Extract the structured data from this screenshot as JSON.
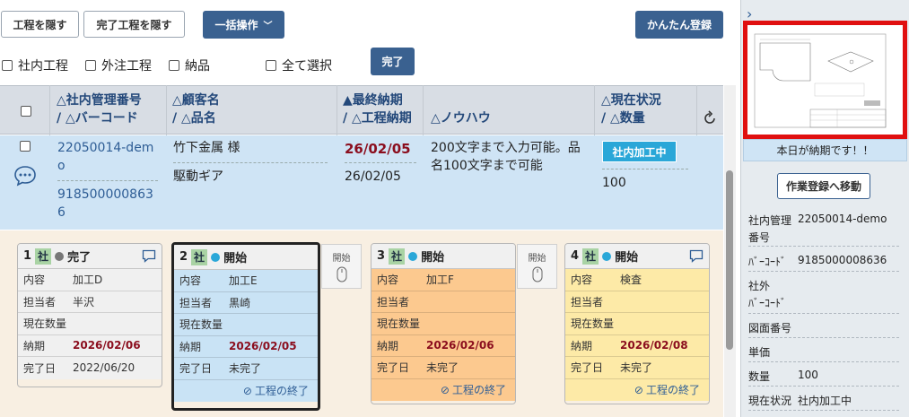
{
  "toolbar": {
    "hide_process": "工程を隠す",
    "hide_done": "完了工程を隠す",
    "bulk": "一括操作",
    "quick_register": "かんたん登録",
    "complete": "完了"
  },
  "filters": {
    "internal": "社内工程",
    "external": "外注工程",
    "delivery": "納品",
    "select_all": "全て選択"
  },
  "header": {
    "col1_a": "△社内管理番号",
    "col1_b": "/ △バーコード",
    "col2_a": "△顧客名",
    "col2_b": "/ △品名",
    "col3_a": "▲最終納期",
    "col3_b": "/ △工程納期",
    "col4": "△ノウハウ",
    "col5_a": "△現在状況",
    "col5_b": "/ △数量"
  },
  "row": {
    "mgmt_no_l1": "22050014-dem",
    "mgmt_no_l2": "o",
    "barcode_l1": "918500000863",
    "barcode_l2": "6",
    "customer": "竹下金属 様",
    "product": "駆動ギア",
    "final_due": "26/02/05",
    "process_due": "26/02/05",
    "knowhow_l1": "200文字まで入力可能。品",
    "knowhow_l2": "名100文字まで可能",
    "status": "社内加工中",
    "qty": "100"
  },
  "cards": [
    {
      "num": "1",
      "sha": "社",
      "state": "完了",
      "dot": "#777777",
      "bg": "#f0f0f0",
      "body": "#f0f0f0",
      "rows": [
        [
          "内容",
          "加工D"
        ],
        [
          "担当者",
          "半沢"
        ],
        [
          "現在数量",
          ""
        ],
        [
          "納期",
          "2026/02/06"
        ],
        [
          "完了日",
          "2022/06/20"
        ]
      ],
      "foot": ""
    },
    {
      "num": "2",
      "sha": "社",
      "state": "開始",
      "dot": "#2aa7d8",
      "bg": "#c9e3f5",
      "body": "#c9e3f5",
      "rows": [
        [
          "内容",
          "加工E"
        ],
        [
          "担当者",
          "黒崎"
        ],
        [
          "現在数量",
          ""
        ],
        [
          "納期",
          "2026/02/05"
        ],
        [
          "完了日",
          "未完了"
        ]
      ],
      "foot": "工程の終了"
    },
    {
      "num": "3",
      "sha": "社",
      "state": "開始",
      "dot": "#2aa7d8",
      "bg": "#f0f0f0",
      "body": "#fcc98f",
      "rows": [
        [
          "内容",
          "加工F"
        ],
        [
          "担当者",
          ""
        ],
        [
          "現在数量",
          ""
        ],
        [
          "納期",
          "2026/02/06"
        ],
        [
          "完了日",
          "未完了"
        ]
      ],
      "foot": "工程の終了"
    },
    {
      "num": "4",
      "sha": "社",
      "state": "開始",
      "dot": "#2aa7d8",
      "bg": "#f0f0f0",
      "body": "#fdeaa7",
      "rows": [
        [
          "内容",
          "検査"
        ],
        [
          "担当者",
          ""
        ],
        [
          "現在数量",
          ""
        ],
        [
          "納期",
          "2026/02/08"
        ],
        [
          "完了日",
          "未完了"
        ]
      ],
      "foot": "工程の終了"
    }
  ],
  "start_label": "開始",
  "right": {
    "due_today": "本日が納期です！！",
    "goto_work": "作業登録へ移動",
    "mgmt_label_1": "社内管理",
    "mgmt_label_2": "番号",
    "mgmt_value": "22050014-demo",
    "barcode_label": "ﾊﾞｰｺｰﾄﾞ",
    "barcode_value": "9185000008636",
    "ext_label_1": "社外",
    "ext_label_2": "ﾊﾞｰｺｰﾄﾞ",
    "drawing_label": "図面番号",
    "price_label": "単価",
    "qty_label": "数量",
    "qty_value": "100",
    "status_label": "現在状況",
    "status_value": "社内加工中"
  },
  "colors": {
    "navy": "#3a6190",
    "header_text": "#23487a",
    "due_red": "#8b0e1e",
    "status_blue": "#2aa7d8",
    "highlight_red": "#e01010"
  }
}
